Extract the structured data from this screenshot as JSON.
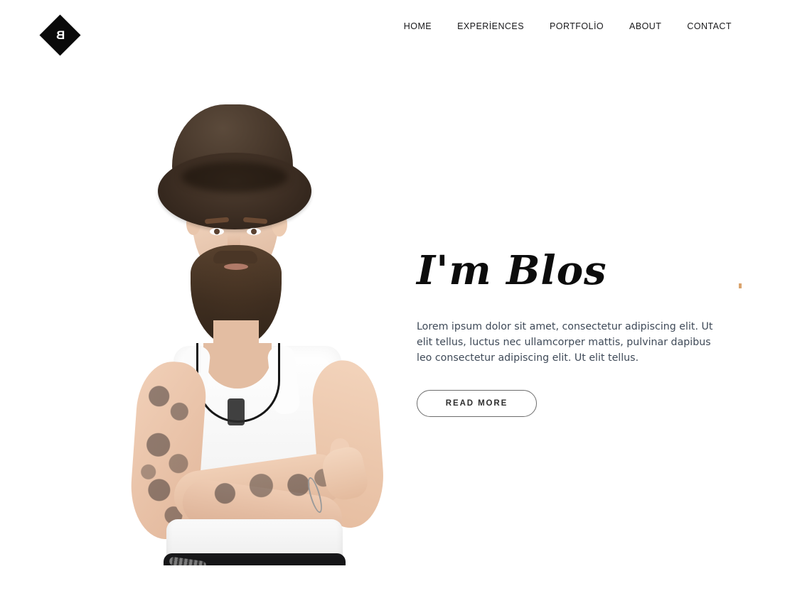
{
  "site": {
    "background_color": "#ffffff",
    "accent_color": "#0a0a0a",
    "text_color": "#19191b",
    "body_text_color": "#3f4a58"
  },
  "header": {
    "logo": {
      "letter": "B",
      "shape": "diamond",
      "shape_color": "#0a0a0a",
      "letter_color": "#ffffff"
    },
    "nav": {
      "items": [
        {
          "label": "HOME"
        },
        {
          "label": "EXPERİENCES"
        },
        {
          "label": "PORTFOLİO"
        },
        {
          "label": "ABOUT"
        },
        {
          "label": "CONTACT"
        }
      ]
    }
  },
  "hero": {
    "title": "I'm Blos",
    "description": "Lorem ipsum dolor sit amet, consectetur adipiscing elit. Ut elit tellus, luctus nec ullamcorper mattis, pulvinar dapibus leo consectetur adipiscing elit. Ut elit tellus.",
    "cta_label": "READ MORE",
    "photo": {
      "alt": "Bearded man wearing a dark brown fedora hat and white tank top with tattooed arms crossed",
      "hat_color": "#3d2e23",
      "shirt_color": "#ffffff",
      "pants_color": "#14141a",
      "skin_color": "#eccdb6",
      "tattoo_color": "#2d2d34"
    }
  }
}
